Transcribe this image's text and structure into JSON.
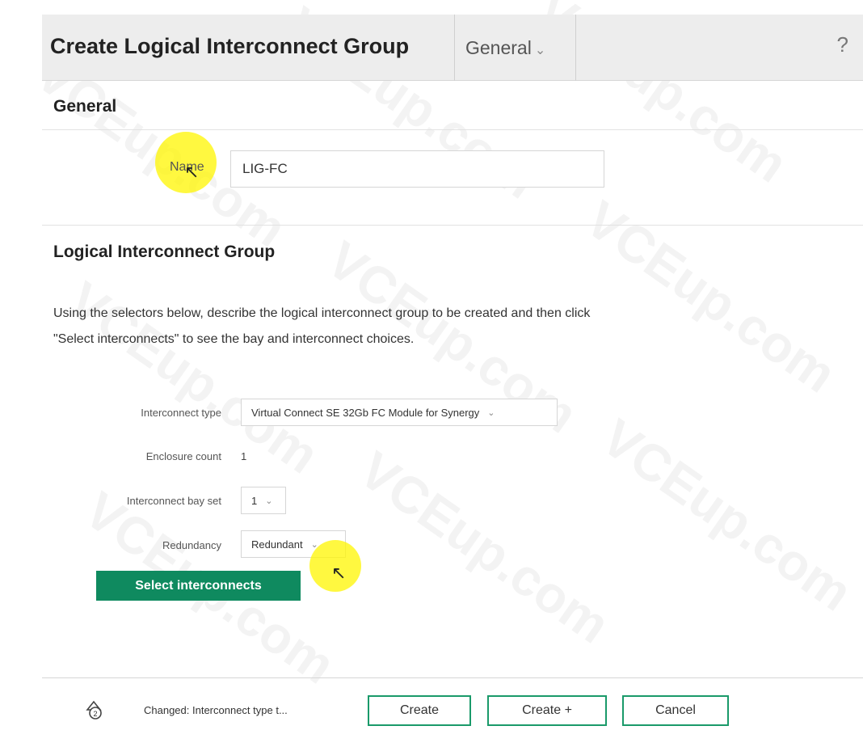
{
  "header": {
    "title": "Create Logical Interconnect Group",
    "section_select": "General",
    "help": "?"
  },
  "general": {
    "heading": "General",
    "name_label": "Name",
    "name_value": "LIG-FC"
  },
  "lig": {
    "heading": "Logical Interconnect Group",
    "description": "Using the selectors below, describe the logical interconnect group to be created and then click \"Select interconnects\" to see the bay and interconnect choices.",
    "interconnect_type_label": "Interconnect type",
    "interconnect_type_value": "Virtual Connect SE 32Gb FC Module for Synergy",
    "enclosure_count_label": "Enclosure count",
    "enclosure_count_value": "1",
    "bay_set_label": "Interconnect bay set",
    "bay_set_value": "1",
    "redundancy_label": "Redundancy",
    "redundancy_value": "Redundant",
    "select_button": "Select interconnects"
  },
  "footer": {
    "status_text": "Changed: Interconnect type t...",
    "status_count": "2",
    "create": "Create",
    "create_plus": "Create +",
    "cancel": "Cancel"
  },
  "watermark": "VCEup.com",
  "colors": {
    "primary_green": "#0f8a5f",
    "outline_green": "#1a9a6a",
    "header_bg": "#ededed",
    "highlight": "#fff500"
  }
}
